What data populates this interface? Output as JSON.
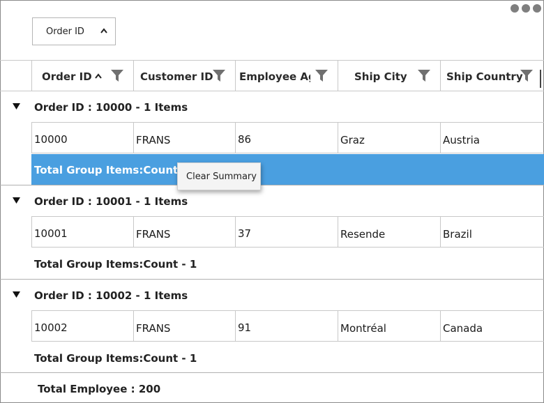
{
  "toolbar": {
    "more_icon": "more-horizontal-icon"
  },
  "group_drop_area": {
    "chip_label": "Order ID",
    "chip_icon": "chevron-up-icon"
  },
  "columns": [
    {
      "label": "Order ID",
      "sorted": "ascending",
      "filter_icon": "filter-icon"
    },
    {
      "label": "Customer ID",
      "filter_icon": "filter-icon"
    },
    {
      "label": "Employee Age",
      "filter_icon": "filter-icon"
    },
    {
      "label": "Ship City",
      "filter_icon": "filter-icon"
    },
    {
      "label": "Ship Country",
      "filter_icon": "filter-icon"
    }
  ],
  "groups": [
    {
      "caption": "Order ID : 10000 - 1 Items",
      "row": [
        "10000",
        "FRANS",
        "86",
        "Graz",
        "Austria"
      ],
      "summary": "Total Group Items:Count - 1",
      "selected": true
    },
    {
      "caption": "Order ID : 10001 - 1 Items",
      "row": [
        "10001",
        "FRANS",
        "37",
        "Resende",
        "Brazil"
      ],
      "summary": "Total Group Items:Count - 1",
      "selected": false
    },
    {
      "caption": "Order ID : 10002 - 1 Items",
      "row": [
        "10002",
        "FRANS",
        "91",
        "Montréal",
        "Canada"
      ],
      "summary": "Total Group Items:Count - 1",
      "selected": false
    }
  ],
  "context_menu": {
    "items": [
      "Clear Summary"
    ]
  },
  "table_summary": "Total Employee : 200",
  "colors": {
    "selected_row": "#4a9fe0",
    "border": "#c8c8c8",
    "icon": "#7f7f7f"
  }
}
